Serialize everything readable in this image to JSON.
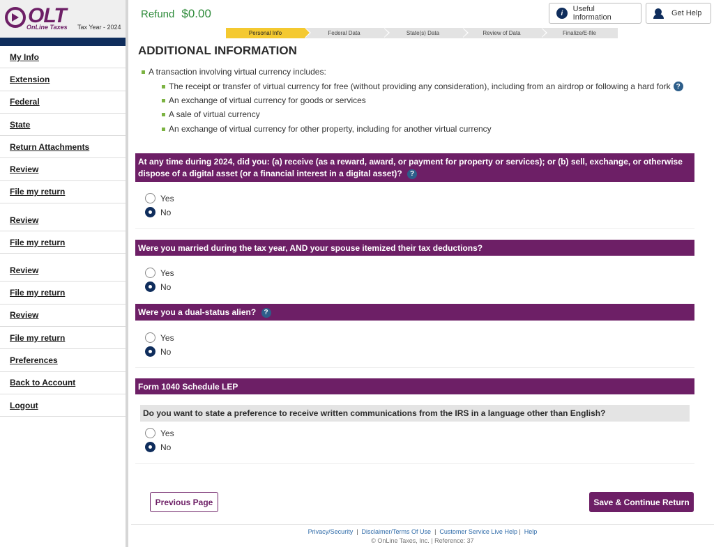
{
  "brand": {
    "logo": "OLT",
    "logo_sub": "OnLine Taxes",
    "tax_year": "Tax Year - 2024",
    "accent": "#6d1f66",
    "navy": "#0f2d5c"
  },
  "sidebar": {
    "items": [
      {
        "label": "My Info"
      },
      {
        "label": "Extension"
      },
      {
        "label": "Federal"
      },
      {
        "label": "State"
      },
      {
        "label": "Return Attachments"
      },
      {
        "label": "Review"
      },
      {
        "label": "File my return"
      },
      {
        "label": "Review"
      },
      {
        "label": "File my return"
      },
      {
        "label": "Review"
      },
      {
        "label": "File my return"
      },
      {
        "label": "Review"
      },
      {
        "label": "File my return"
      },
      {
        "label": "Preferences"
      },
      {
        "label": "Back to Account"
      },
      {
        "label": "Logout"
      }
    ]
  },
  "header": {
    "refund_label": "Refund",
    "refund_amount": "$0.00",
    "useful_info": "Useful Information",
    "get_help": "Get Help"
  },
  "steps": [
    "Personal Info",
    "Federal Data",
    "State(s) Data",
    "Review of Data",
    "Finalize/E-file"
  ],
  "page": {
    "title": "ADDITIONAL INFORMATION",
    "intro": "A transaction involving virtual currency includes:",
    "bullets": [
      "The receipt or transfer of virtual currency for free (without providing any consideration), including from an airdrop or following a hard fork",
      "An exchange of virtual currency for goods or services",
      "A sale of virtual currency",
      "An exchange of virtual currency for other property, including for another virtual currency"
    ]
  },
  "questions": {
    "q1": "At any time during 2024, did you: (a) receive (as a reward, award, or payment for property or services); or (b) sell, exchange, or otherwise dispose of a digital asset (or a financial interest in a digital asset)?",
    "q2": "Were you married during the tax year, AND your spouse itemized their tax deductions?",
    "q3": "Were you a dual-status alien?",
    "section": "Form 1040 Schedule LEP",
    "q4": "Do you want to state a preference to receive written communications from the IRS in a language other than English?",
    "yes": "Yes",
    "no": "No",
    "help_glyph": "?"
  },
  "buttons": {
    "previous": "Previous Page",
    "save": "Save & Continue Return"
  },
  "footer": {
    "links": [
      "Privacy/Security",
      "Disclaimer/Terms Of Use",
      "Customer Service Live Help",
      "Help"
    ],
    "copyright": "© OnLine Taxes, Inc. | Reference: 37"
  }
}
